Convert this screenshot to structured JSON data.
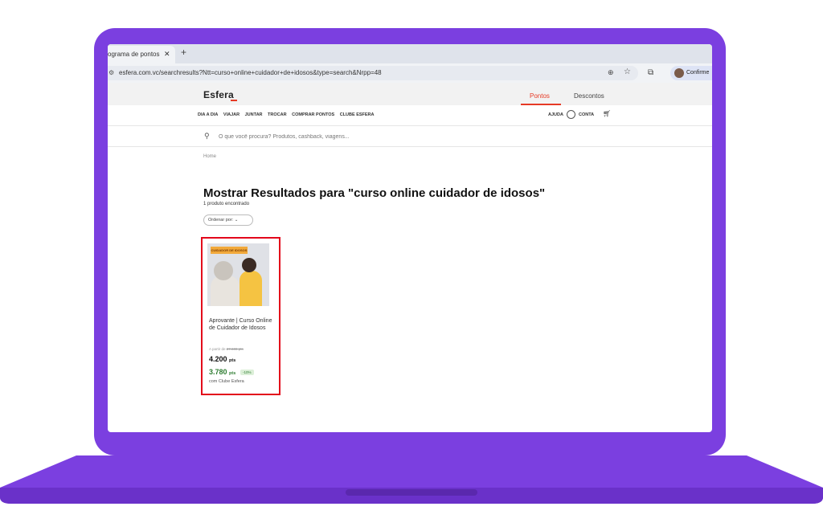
{
  "browser": {
    "tab_title": "ograma de pontos",
    "tab_close": "✕",
    "new_tab": "+",
    "url": "esfera.com.vc/searchresults?Ntt=curso+online+cuidador+de+idosos&type=search&Nrpp=48",
    "profile_label": "Confirme"
  },
  "site": {
    "logo": "Esfera",
    "top_tabs": [
      "Pontos",
      "Descontos"
    ],
    "nav": [
      "DIA A DIA",
      "VIAJAR",
      "JUNTAR",
      "TROCAR",
      "COMPRAR PONTOS",
      "CLUBE ESFERA"
    ],
    "help": "AJUDA",
    "account": "CONTA",
    "search_placeholder": "O que você procura? Produtos, cashback, viagens..."
  },
  "results": {
    "breadcrumb": "Home",
    "title": "Mostrar Resultados para \"curso online cuidador de idosos\"",
    "count": "1 produto encontrado",
    "sort_label": "Ordenar por:"
  },
  "product": {
    "image_banner": "CUIDADOR DE IDOSOS",
    "title": "Aprovante | Curso Online de Cuidador de Idosos",
    "from_label": "A partir de",
    "old_price": "27.600 pts",
    "price": "4.200",
    "price_unit": "pts",
    "club_price": "3.780",
    "club_unit": "pts",
    "club_discount": "-10%",
    "club_note": "com Clube Esfera"
  },
  "colors": {
    "laptop": "#7b3fe0",
    "accent": "#e63a25",
    "highlight": "#e3081b",
    "club_green": "#2f7d32"
  }
}
